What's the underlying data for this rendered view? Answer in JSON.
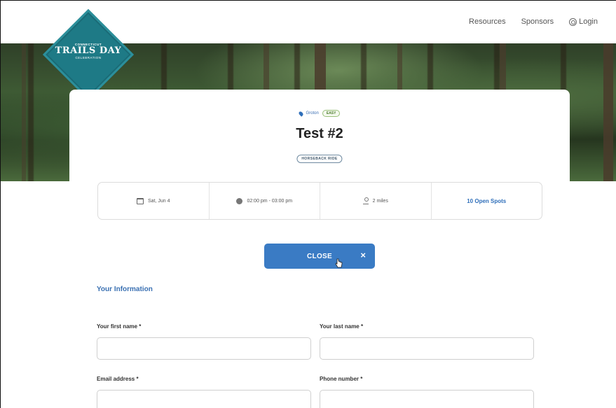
{
  "nav": {
    "resources": "Resources",
    "sponsors": "Sponsors",
    "login": "Login"
  },
  "logo": {
    "line1": "CONNECTICUT",
    "line2": "TRAILS DAY",
    "line3": "CELEBRATION"
  },
  "event": {
    "location": "Groton",
    "difficulty": "EASY",
    "title": "Test #2",
    "activity_tag": "HORSEBACK RIDE"
  },
  "details": {
    "date": "Sat, Jun 4",
    "time": "02:00 pm - 03:00 pm",
    "distance": "2 miles",
    "open_spots": "10 Open Spots"
  },
  "close_button": {
    "label": "CLOSE",
    "icon": "×"
  },
  "form": {
    "section_title": "Your Information",
    "first_name_label": "Your first name *",
    "last_name_label": "Your last name *",
    "email_label": "Email address *",
    "phone_label": "Phone number *",
    "first_name_value": "",
    "last_name_value": "",
    "email_value": "",
    "phone_value": ""
  },
  "colors": {
    "accent": "#3a7bc4",
    "logo_teal": "#1e7a86",
    "easy_green": "#4f7f2f"
  }
}
